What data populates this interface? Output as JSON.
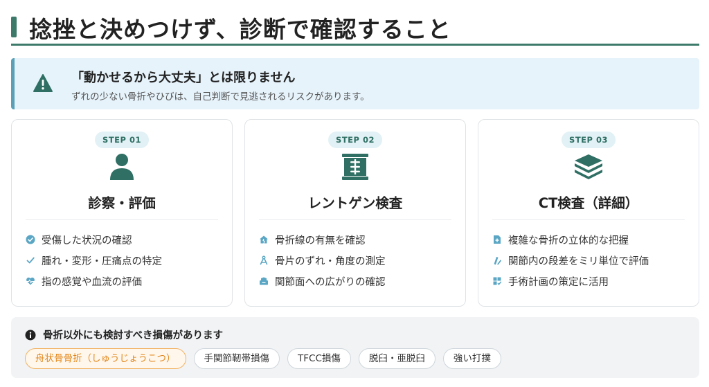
{
  "header": {
    "title": "捻挫と決めつけず、診断で確認すること"
  },
  "alert": {
    "title": "「動かせるから大丈夫」とは限りません",
    "description": "ずれの少ない骨折やひびは、自己判断で見逃されるリスクがあります。"
  },
  "steps": [
    {
      "badge": "STEP 01",
      "icon": "person-icon",
      "title": "診察・評価",
      "items": [
        {
          "icon": "check-badge-icon",
          "text": "受傷した状況の確認"
        },
        {
          "icon": "check-icon",
          "text": "腫れ・変形・圧痛点の特定"
        },
        {
          "icon": "heart-pulse-icon",
          "text": "指の感覚や血流の評価"
        }
      ]
    },
    {
      "badge": "STEP 02",
      "icon": "xray-icon",
      "title": "レントゲン検査",
      "items": [
        {
          "icon": "house-crack-icon",
          "text": "骨折線の有無を確認"
        },
        {
          "icon": "ruler-angle-icon",
          "text": "骨片のずれ・角度の測定"
        },
        {
          "icon": "bone-expand-icon",
          "text": "関節面への広がりの確認"
        }
      ]
    },
    {
      "badge": "STEP 03",
      "icon": "layers-icon",
      "title": "CT検査（詳細）",
      "items": [
        {
          "icon": "file-medical-icon",
          "text": "複雑な骨折の立体的な把握"
        },
        {
          "icon": "ruler-icon",
          "text": "関節内の段差をミリ単位で評価"
        },
        {
          "icon": "clipboard-plan-icon",
          "text": "手術計画の策定に活用"
        }
      ]
    }
  ],
  "other_injuries": {
    "title": "骨折以外にも検討すべき損傷があります",
    "tags": [
      "舟状骨骨折（しゅうじょうこつ）",
      "手関節靭帯損傷",
      "TFCC損傷",
      "脱臼・亜脱臼",
      "強い打撲"
    ]
  },
  "colors": {
    "accent": "#3d7a6a",
    "alert_bg": "#e6f3fb",
    "badge_bg": "#e2f1f5",
    "highlight": "#e2871c",
    "item_icon": "#5aa6c4"
  }
}
